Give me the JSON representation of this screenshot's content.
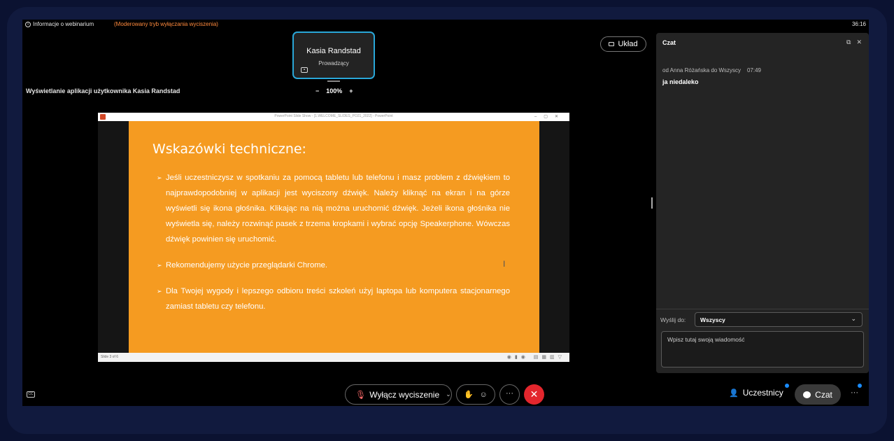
{
  "topbar": {
    "info_label": "Informacje o webinarium",
    "moderated_label": "(Moderowany tryb wyłączania wyciszenia)",
    "timer": "36:16"
  },
  "presenter": {
    "name": "Kasia Randstad",
    "role": "Prowadzący"
  },
  "layout_button": "Układ",
  "share": {
    "label": "Wyświetlanie aplikacji użytkownika Kasia Randstad",
    "zoom_out": "−",
    "zoom_value": "100%",
    "zoom_in": "+"
  },
  "slide": {
    "window_title": "PowerPoint Slide Show - [1.WELCOME_SLIDES_PO21_2022] - PowerPoint",
    "title": "Wskazówki techniczne:",
    "bullets": [
      "Jeśli uczestniczysz w spotkaniu za pomocą tabletu lub telefonu i masz problem z dźwiękiem to najprawdopodobniej w aplikacji jest wyciszony dźwięk. Należy kliknąć na ekran i na górze wyświetli się ikona głośnika. Klikając na nią można uruchomić dźwięk. Jeżeli ikona głośnika nie wyświetla się, należy rozwinąć pasek z trzema kropkami i wybrać opcję Speakerphone. Wówczas dźwięk powinien się uruchomić.",
      "Rekomendujemy użycie przeglądarki Chrome.",
      "Dla Twojej wygody i lepszego odbioru treści szkoleń użyj laptopa lub komputera stacjonarnego zamiast tabletu czy telefonu."
    ],
    "status": "Slide 3 of 6"
  },
  "chat": {
    "title": "Czat",
    "message": {
      "meta": "od Anna Różańska do Wszyscy",
      "time": "07:49",
      "text": "ja niedaleko"
    },
    "send_to_label": "Wyślij do:",
    "send_to_value": "Wszyscy",
    "input_placeholder": "Wpisz tutaj swoją wiadomość"
  },
  "bottom": {
    "mute_label": "Wyłącz wyciszenie",
    "participants_label": "Uczestnicy",
    "chat_label": "Czat",
    "more": "···",
    "overflow": "···"
  },
  "colors": {
    "accent_blue": "#29a7d8",
    "warning_orange": "#ff8a3d",
    "slide_orange": "#f59b21",
    "leave_red": "#e3262d",
    "notification_dot": "#1a8cff"
  }
}
